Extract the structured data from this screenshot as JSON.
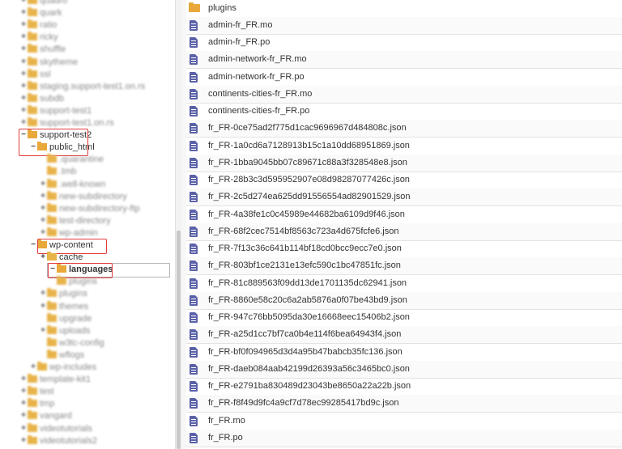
{
  "tree": {
    "blurred_top": [
      {
        "label": "quadro",
        "toggle": "+"
      },
      {
        "label": "quark",
        "toggle": "+"
      },
      {
        "label": "ratio",
        "toggle": "+"
      },
      {
        "label": "ricky",
        "toggle": "+"
      },
      {
        "label": "shuffle",
        "toggle": "+"
      },
      {
        "label": "skytheme",
        "toggle": "+"
      },
      {
        "label": "ssl",
        "toggle": "+"
      },
      {
        "label": "staging.support-test1.on.rs",
        "toggle": "+"
      },
      {
        "label": "subdb",
        "toggle": "+"
      },
      {
        "label": "support-test1",
        "toggle": "+"
      },
      {
        "label": "support-test1.on.rs",
        "toggle": "+"
      }
    ],
    "support_test2": {
      "label": "support-test2",
      "toggle": "−"
    },
    "public_html": {
      "label": "public_html",
      "toggle": "−"
    },
    "blurred_mid": [
      {
        "label": ".quarantine",
        "toggle": ""
      },
      {
        "label": ".tmb",
        "toggle": ""
      },
      {
        "label": ".well-known",
        "toggle": "+"
      },
      {
        "label": "new-subdirectory",
        "toggle": "+"
      },
      {
        "label": "new-subdirectory-ftp",
        "toggle": "+"
      },
      {
        "label": "test-directory",
        "toggle": "+"
      },
      {
        "label": "wp-admin",
        "toggle": "+"
      }
    ],
    "wp_content": {
      "label": "wp-content",
      "toggle": "−"
    },
    "cache": {
      "label": "cache",
      "toggle": "+"
    },
    "languages": {
      "label": "languages",
      "toggle": "−"
    },
    "blurred_low": [
      {
        "label": "plugins",
        "toggle": "",
        "indent": 3
      },
      {
        "label": "plugins",
        "toggle": "+",
        "indent": 2
      },
      {
        "label": "themes",
        "toggle": "+",
        "indent": 2
      },
      {
        "label": "upgrade",
        "toggle": "",
        "indent": 2
      },
      {
        "label": "uploads",
        "toggle": "+",
        "indent": 2
      },
      {
        "label": "w3tc-config",
        "toggle": "",
        "indent": 2
      },
      {
        "label": "wflogs",
        "toggle": "",
        "indent": 2
      },
      {
        "label": "wp-includes",
        "toggle": "+",
        "indent": 1
      },
      {
        "label": "template-kit1",
        "toggle": "+",
        "indent": 0
      },
      {
        "label": "test",
        "toggle": "+",
        "indent": 0
      },
      {
        "label": "tmp",
        "toggle": "+",
        "indent": 0
      },
      {
        "label": "vangard",
        "toggle": "+",
        "indent": 0
      },
      {
        "label": "videotutorials",
        "toggle": "+",
        "indent": 0
      },
      {
        "label": "videotutorials2",
        "toggle": "+",
        "indent": 0
      }
    ]
  },
  "files": [
    {
      "name": "plugins",
      "type": "folder"
    },
    {
      "name": "admin-fr_FR.mo",
      "type": "file"
    },
    {
      "name": "admin-fr_FR.po",
      "type": "file"
    },
    {
      "name": "admin-network-fr_FR.mo",
      "type": "file"
    },
    {
      "name": "admin-network-fr_FR.po",
      "type": "file"
    },
    {
      "name": "continents-cities-fr_FR.mo",
      "type": "file"
    },
    {
      "name": "continents-cities-fr_FR.po",
      "type": "file"
    },
    {
      "name": "fr_FR-0ce75ad2f775d1cac9696967d484808c.json",
      "type": "file"
    },
    {
      "name": "fr_FR-1a0cd6a7128913b15c1a10dd68951869.json",
      "type": "file"
    },
    {
      "name": "fr_FR-1bba9045bb07c89671c88a3f328548e8.json",
      "type": "file"
    },
    {
      "name": "fr_FR-28b3c3d595952907e08d98287077426c.json",
      "type": "file"
    },
    {
      "name": "fr_FR-2c5d274ea625dd91556554ad82901529.json",
      "type": "file"
    },
    {
      "name": "fr_FR-4a38fe1c0c45989e44682ba6109d9f46.json",
      "type": "file"
    },
    {
      "name": "fr_FR-68f2cec7514bf8563c723a4d675fcfe6.json",
      "type": "file"
    },
    {
      "name": "fr_FR-7f13c36c641b114bf18cd0bcc9ecc7e0.json",
      "type": "file"
    },
    {
      "name": "fr_FR-803bf1ce2131e13efc590c1bc47851fc.json",
      "type": "file"
    },
    {
      "name": "fr_FR-81c889563f09dd13de1701135dc62941.json",
      "type": "file"
    },
    {
      "name": "fr_FR-8860e58c20c6a2ab5876a0f07be43bd9.json",
      "type": "file"
    },
    {
      "name": "fr_FR-947c76bb5095da30e16668eec15406b2.json",
      "type": "file"
    },
    {
      "name": "fr_FR-a25d1cc7bf7ca0b4e114f6bea64943f4.json",
      "type": "file"
    },
    {
      "name": "fr_FR-bf0f094965d3d4a95b47babcb35fc136.json",
      "type": "file"
    },
    {
      "name": "fr_FR-daeb084aab42199d26393a56c3465bc0.json",
      "type": "file"
    },
    {
      "name": "fr_FR-e2791ba830489d23043be8650a22a22b.json",
      "type": "file"
    },
    {
      "name": "fr_FR-f8f49d9fc4a9cf7d78ec99285417bd9c.json",
      "type": "file"
    },
    {
      "name": "fr_FR.mo",
      "type": "file"
    },
    {
      "name": "fr_FR.po",
      "type": "file"
    }
  ],
  "colors": {
    "highlight": "#e23b3b",
    "folder": "#e8a83a",
    "file_icon": "#5b62a8"
  },
  "icons": {
    "folder": "folder-icon",
    "file": "file-icon"
  }
}
